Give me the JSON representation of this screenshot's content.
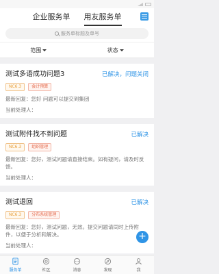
{
  "tabs": [
    {
      "label": "企业服务单",
      "active": false
    },
    {
      "label": "用友服务单",
      "active": true
    }
  ],
  "search": {
    "placeholder": "服务单标题及单号"
  },
  "filters": [
    {
      "label": "范围"
    },
    {
      "label": "状态"
    }
  ],
  "tickets": [
    {
      "title": "测试多语成功问题3",
      "status": "已解决，问题关闭",
      "version_tag": "NC6.3",
      "module_tag": "会计预算",
      "reply": "最新回复：您好 问题可以提交到集团",
      "handler": "当前处理人："
    },
    {
      "title": "测试附件找不到问题",
      "status": "已解决",
      "version_tag": "NC6.3",
      "module_tag": "组织管理",
      "reply": "最新回复：您好，测试问题请直接结束。如有疑问，请及时反馈。",
      "handler": "当前处理人："
    },
    {
      "title": "测试退回",
      "status": "已解决",
      "version_tag": "NC6.3",
      "module_tag": "分布系统管理",
      "reply": "最新回复：您好，测试问题，无效。提交问题请同时上传附件，以便于分析和解决。",
      "handler": "当前处理人："
    }
  ],
  "fab": {
    "label": "+"
  },
  "bottom_nav": [
    {
      "label": "服务单",
      "icon": "ticket-icon",
      "active": true
    },
    {
      "label": "社区",
      "icon": "community-icon",
      "active": false
    },
    {
      "label": "消息",
      "icon": "message-icon",
      "active": false
    },
    {
      "label": "发现",
      "icon": "compass-icon",
      "active": false
    },
    {
      "label": "我",
      "icon": "person-icon",
      "active": false
    }
  ],
  "colors": {
    "accent": "#2f94e6",
    "version_tag": "#e8a03d",
    "module_tag": "#e46a4c"
  }
}
